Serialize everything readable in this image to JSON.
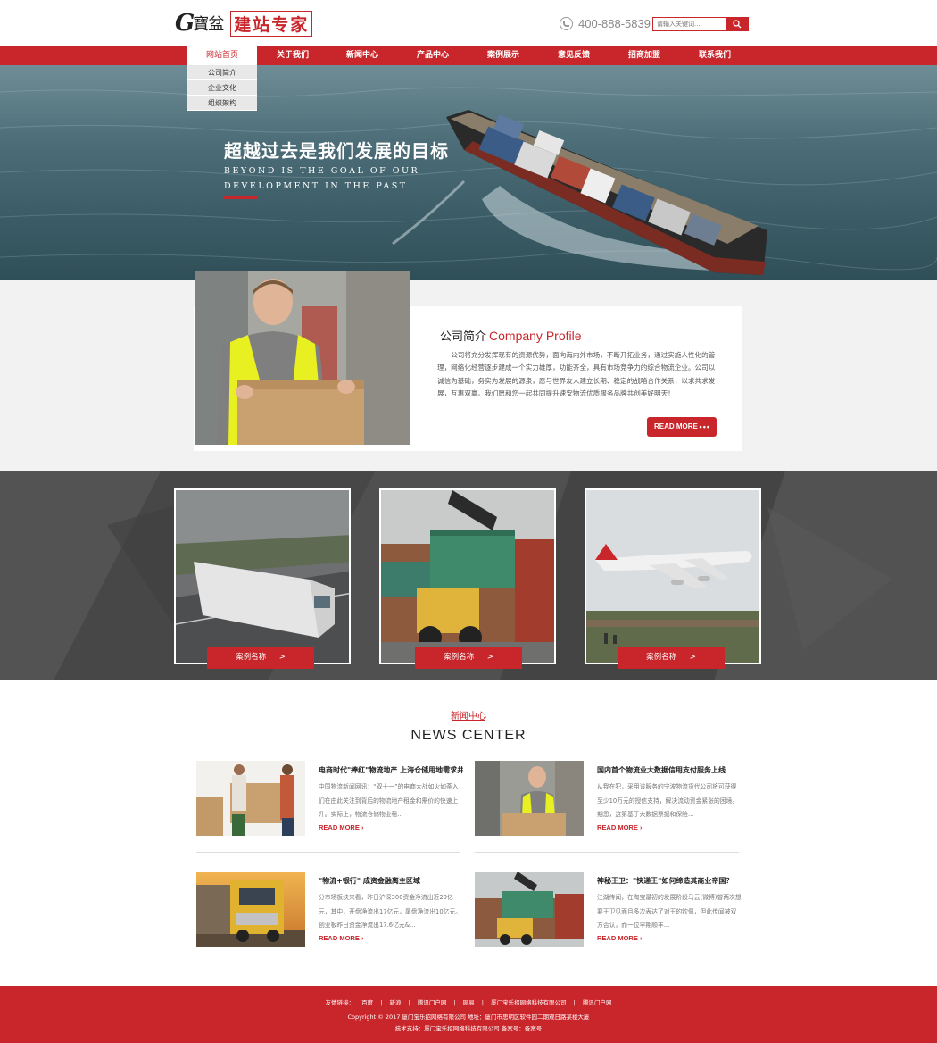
{
  "header": {
    "logo_mark": "G",
    "logo_cn": "寶盆",
    "logo_tagline": "建站专家",
    "phone": "400-888-5839",
    "search_placeholder": "请输入关键词...."
  },
  "nav": {
    "items": [
      {
        "label": "网站首页"
      },
      {
        "label": "关于我们"
      },
      {
        "label": "新闻中心"
      },
      {
        "label": "产品中心"
      },
      {
        "label": "案例展示"
      },
      {
        "label": "意见反馈"
      },
      {
        "label": "招商加盟"
      },
      {
        "label": "联系我们"
      }
    ],
    "submenu": [
      "公司简介",
      "企业文化",
      "组织架构"
    ]
  },
  "banner": {
    "title": "超越过去是我们发展的目标",
    "subtitle": "BEYOND IS THE GOAL OF OUR DEVELOPMENT IN THE PAST"
  },
  "profile": {
    "title_cn": "公司简介",
    "title_en": "Company Profile",
    "text": "公司将充分发挥现有的资源优势，面向海内外市场，不断开拓业务，通过实施人性化的管理，网络化经营逐步建成一个实力雄厚，功能齐全，具有市场竞争力的综合物流企业。公司以诚信为基础，务实为发展的源泉，愿与世界友人建立长期、稳定的战略合作关系，以求共求发展，互惠双赢。我们愿和您一起共同提升速安物流优质服务品牌共创美好明天！",
    "button": "READ MORE",
    "button_dots": "•••"
  },
  "cases": [
    {
      "label": "案例名称",
      "arrow": ">"
    },
    {
      "label": "案例名称",
      "arrow": ">"
    },
    {
      "label": "案例名称",
      "arrow": ">"
    }
  ],
  "news": {
    "subtitle": "新闻中心",
    "title": "NEWS CENTER",
    "items": [
      {
        "headline": "电商时代\"捧红\"物流地产 上海仓储用地需求井...",
        "desc": "中国物流新闻网讯：“双十一”的电商大战如火如荼入们在由此关注到背后的物流地产租金和需价的快速上升。实际上，物流仓储物业租...",
        "more": "READ MORE"
      },
      {
        "headline": "国内首个物流业大数据信用支付服务上线",
        "desc": "从我在犯，采用该服务的宁波物流货代公司将可获得至少10万元的授信支持，解决流动资金紧张的困境。期恩，这第基于大数据票据和保险...",
        "more": "READ MORE"
      },
      {
        "headline": "\"物流+银行\" 成资金融离主区域",
        "desc": "分市场板块来看，昨日沪深300资金净流出近29亿元，其中，开盘净流出17亿元，尾盘净流出10亿元。创业板昨日资金净流出17.6亿元&...",
        "more": "READ MORE"
      },
      {
        "headline": "神秘王卫：\"快递王\"如何缔造其商业帝国？",
        "desc": "江湖传闻，在淘宝最初的发展阶段马云(微博)曾两次想要王卫见面且多次表达了对王的钦佩，但此传闻被双方否认，而一位早期顺丰...",
        "more": "READ MORE"
      }
    ]
  },
  "footer": {
    "links": [
      "友情链接：",
      "百度",
      "|",
      "新浪",
      "|",
      "腾讯门户网",
      "|",
      "网易",
      "|",
      "厦门宝乐招网络科技有限公司",
      "|",
      "腾讯门户网"
    ],
    "copyright": "Copyright © 2017 厦门宝乐招网络有限公司  地址：厦门市思明区软件园二期观日路某楼大厦",
    "support": "技术支持：厦门宝乐招网络科技有限公司 备案号：备案号"
  },
  "colors": {
    "brand_red": "#c8262b",
    "case_bg": "#4a4a4a",
    "profile_bg": "#f2f2f2"
  }
}
